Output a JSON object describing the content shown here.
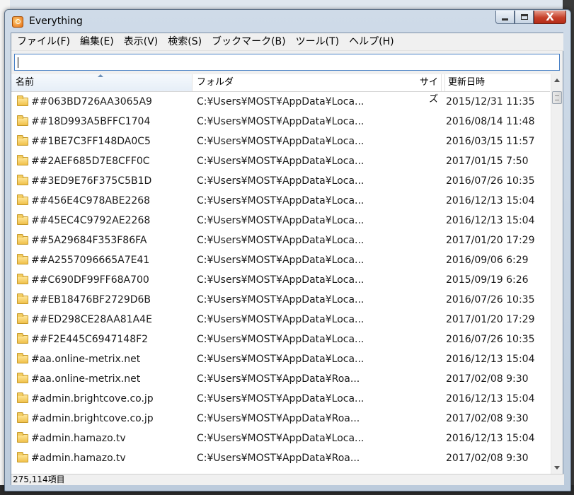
{
  "window": {
    "title": "Everything",
    "minimize_icon": "minimize-icon",
    "maximize_icon": "maximize-icon",
    "close_label": "X"
  },
  "menu": [
    "ファイル(F)",
    "編集(E)",
    "表示(V)",
    "検索(S)",
    "ブックマーク(B)",
    "ツール(T)",
    "ヘルプ(H)"
  ],
  "search": {
    "value": "",
    "placeholder": ""
  },
  "columns": {
    "name": "名前",
    "path": "フォルダ",
    "size": "サイズ",
    "date": "更新日時"
  },
  "rows": [
    {
      "name": "##063BD726AA3065A9",
      "path": "C:¥Users¥MOST¥AppData¥Loca...",
      "date": "2015/12/31 11:35"
    },
    {
      "name": "##18D993A5BFFC1704",
      "path": "C:¥Users¥MOST¥AppData¥Loca...",
      "date": "2016/08/14 11:48"
    },
    {
      "name": "##1BE7C3FF148DA0C5",
      "path": "C:¥Users¥MOST¥AppData¥Loca...",
      "date": "2016/03/15 11:57"
    },
    {
      "name": "##2AEF685D7E8CFF0C",
      "path": "C:¥Users¥MOST¥AppData¥Loca...",
      "date": "2017/01/15 7:50"
    },
    {
      "name": "##3ED9E76F375C5B1D",
      "path": "C:¥Users¥MOST¥AppData¥Loca...",
      "date": "2016/07/26 10:35"
    },
    {
      "name": "##456E4C978ABE2268",
      "path": "C:¥Users¥MOST¥AppData¥Loca...",
      "date": "2016/12/13 15:04"
    },
    {
      "name": "##45EC4C9792AE2268",
      "path": "C:¥Users¥MOST¥AppData¥Loca...",
      "date": "2016/12/13 15:04"
    },
    {
      "name": "##5A29684F353F86FA",
      "path": "C:¥Users¥MOST¥AppData¥Loca...",
      "date": "2017/01/20 17:29"
    },
    {
      "name": "##A2557096665A7E41",
      "path": "C:¥Users¥MOST¥AppData¥Loca...",
      "date": "2016/09/06 6:29"
    },
    {
      "name": "##C690DF99FF68A700",
      "path": "C:¥Users¥MOST¥AppData¥Loca...",
      "date": "2015/09/19 6:26"
    },
    {
      "name": "##EB18476BF2729D6B",
      "path": "C:¥Users¥MOST¥AppData¥Loca...",
      "date": "2016/07/26 10:35"
    },
    {
      "name": "##ED298CE28AA81A4E",
      "path": "C:¥Users¥MOST¥AppData¥Loca...",
      "date": "2017/01/20 17:29"
    },
    {
      "name": "##F2E445C6947148F2",
      "path": "C:¥Users¥MOST¥AppData¥Loca...",
      "date": "2016/07/26 10:35"
    },
    {
      "name": "#aa.online-metrix.net",
      "path": "C:¥Users¥MOST¥AppData¥Loca...",
      "date": "2016/12/13 15:04"
    },
    {
      "name": "#aa.online-metrix.net",
      "path": "C:¥Users¥MOST¥AppData¥Roa...",
      "date": "2017/02/08 9:30"
    },
    {
      "name": "#admin.brightcove.co.jp",
      "path": "C:¥Users¥MOST¥AppData¥Loca...",
      "date": "2016/12/13 15:04"
    },
    {
      "name": "#admin.brightcove.co.jp",
      "path": "C:¥Users¥MOST¥AppData¥Roa...",
      "date": "2017/02/08 9:30"
    },
    {
      "name": "#admin.hamazo.tv",
      "path": "C:¥Users¥MOST¥AppData¥Loca...",
      "date": "2016/12/13 15:04"
    },
    {
      "name": "#admin.hamazo.tv",
      "path": "C:¥Users¥MOST¥AppData¥Roa...",
      "date": "2017/02/08 9:30"
    }
  ],
  "status": {
    "count": "275,114項目"
  },
  "colors": {
    "accent": "#4a82c6",
    "close": "#c6402a",
    "folder": "#f0c04a"
  }
}
